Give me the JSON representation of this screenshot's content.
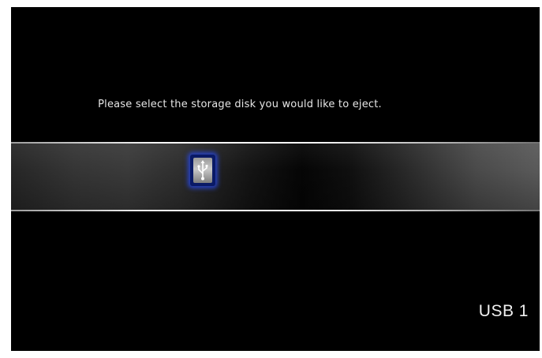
{
  "dialog": {
    "prompt": "Please select the storage disk you would like to eject."
  },
  "devices": [
    {
      "icon": "usb-icon",
      "label": "USB 1",
      "selected": true
    }
  ],
  "colors": {
    "background": "#000000",
    "selection_glow": "#2846dc",
    "text": "#e6e6e6"
  }
}
